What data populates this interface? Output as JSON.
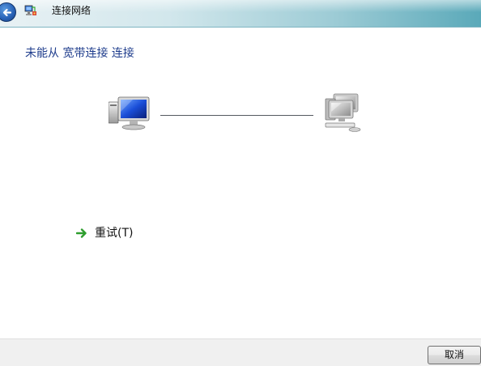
{
  "window": {
    "title": "连接网络",
    "back_icon": "back-arrow-icon",
    "app_icon": "network-connection-icon"
  },
  "main": {
    "heading": "未能从 宽带连接 连接",
    "diagram": {
      "left_icon": "computer-icon",
      "right_icon": "network-icon",
      "connection_status": "failed"
    },
    "retry": {
      "icon": "green-arrow-icon",
      "label": "重试(T)"
    }
  },
  "footer": {
    "cancel_label": "取消"
  },
  "colors": {
    "heading": "#1e3c8c",
    "retry_arrow": "#2e9e2e",
    "titlebar_accent": "#5aa9b9"
  }
}
